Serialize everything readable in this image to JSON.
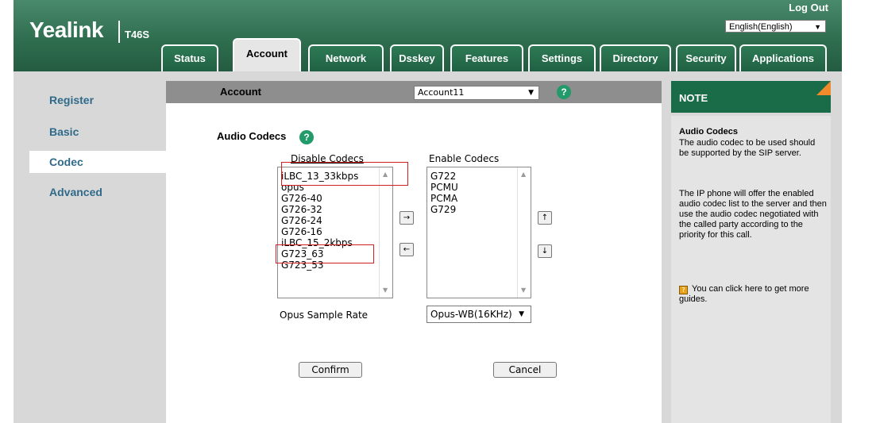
{
  "header": {
    "brand": "Yealink",
    "model": "T46S",
    "logout_label": "Log Out",
    "language": "English(English)"
  },
  "tabs": [
    {
      "label": "Status"
    },
    {
      "label": "Account"
    },
    {
      "label": "Network"
    },
    {
      "label": "Dsskey"
    },
    {
      "label": "Features"
    },
    {
      "label": "Settings"
    },
    {
      "label": "Directory"
    },
    {
      "label": "Security"
    },
    {
      "label": "Applications"
    }
  ],
  "sidebar": {
    "items": [
      {
        "label": "Register"
      },
      {
        "label": "Basic"
      },
      {
        "label": "Codec"
      },
      {
        "label": "Advanced"
      }
    ]
  },
  "account_bar": {
    "label": "Account",
    "selected": "Account11",
    "help": "?"
  },
  "audio_codecs": {
    "title": "Audio Codecs",
    "help": "?",
    "disable_header": "Disable Codecs",
    "enable_header": "Enable Codecs",
    "disabled": [
      "iLBC_13_33kbps",
      "opus",
      "G726-40",
      "G726-32",
      "G726-24",
      "G726-16",
      "iLBC_15_2kbps",
      "G723_63",
      "G723_53"
    ],
    "enabled": [
      "G722",
      "PCMU",
      "PCMA",
      "G729"
    ],
    "move_right": "→",
    "move_left": "←",
    "move_up": "↑",
    "move_down": "↓"
  },
  "opus": {
    "label": "Opus Sample Rate",
    "value": "Opus-WB(16KHz)"
  },
  "buttons": {
    "confirm": "Confirm",
    "cancel": "Cancel"
  },
  "note": {
    "title": "NOTE",
    "subtitle": "Audio Codecs",
    "p1": "The audio codec to be used should be supported by the SIP server.",
    "p2": "The IP phone will offer the enabled audio codec list to the server and then use the audio codec negotiated with the called party according to the priority for this call.",
    "guide": "You can click here to get more guides."
  },
  "colors": {
    "header_green": "#2f6e4f",
    "note_green": "#1a6b47",
    "highlight_red": "#d62020",
    "sidebar_link": "#2f6a8a"
  }
}
